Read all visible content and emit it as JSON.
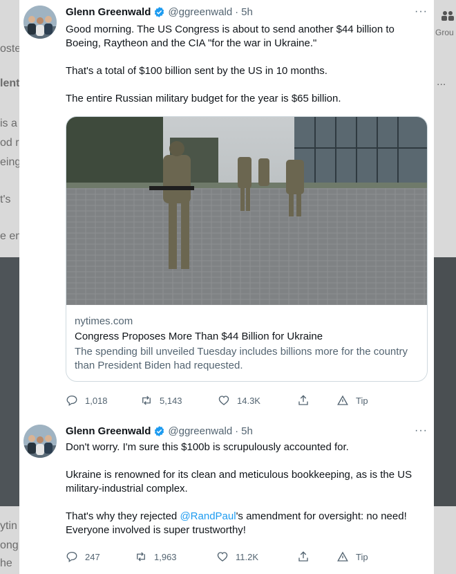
{
  "background": {
    "left_fragments": [
      "oste",
      "lent",
      "is a",
      "od r",
      "eing",
      "t's",
      "e en",
      "ytin",
      "ong",
      "he"
    ],
    "right_fragments": [
      "Grou",
      "..."
    ]
  },
  "tweets": [
    {
      "name": "Glenn Greenwald",
      "handle": "@ggreenwald",
      "separator": "·",
      "time": "5h",
      "more": "···",
      "paragraphs": [
        "Good morning. The US Congress is about to send another $44 billion to Boeing, Raytheon and the CIA \"for the war in Ukraine.\"",
        "That's a total of $100 billion sent by the US in 10 months.",
        "The entire Russian military budget for the year is $65 billion."
      ],
      "link_card": {
        "domain": "nytimes.com",
        "title": "Congress Proposes More Than $44 Billion for Ukraine",
        "description": "The spending bill unveiled Tuesday includes billions more for the country than President Biden had requested."
      },
      "actions": {
        "replies": "1,018",
        "retweets": "5,143",
        "likes": "14.3K",
        "share": "",
        "tip": "Tip"
      }
    },
    {
      "name": "Glenn Greenwald",
      "handle": "@ggreenwald",
      "separator": "·",
      "time": "5h",
      "more": "···",
      "paragraphs": [
        "Don't worry. I'm sure this $100b is scrupulously accounted for.",
        "Ukraine is renowned for its clean and meticulous bookkeeping, as is the US military-industrial complex."
      ],
      "p3_before": "That's why they rejected ",
      "p3_mention": "@RandPaul",
      "p3_after": "'s amendment for oversight: no need! Everyone involved is super trustworthy!",
      "actions": {
        "replies": "247",
        "retweets": "1,963",
        "likes": "11.2K",
        "share": "",
        "tip": "Tip"
      }
    }
  ],
  "colors": {
    "accent": "#1d9bf0",
    "secondary_text": "#536471",
    "primary_text": "#0f1419",
    "border": "#cfd9de"
  }
}
